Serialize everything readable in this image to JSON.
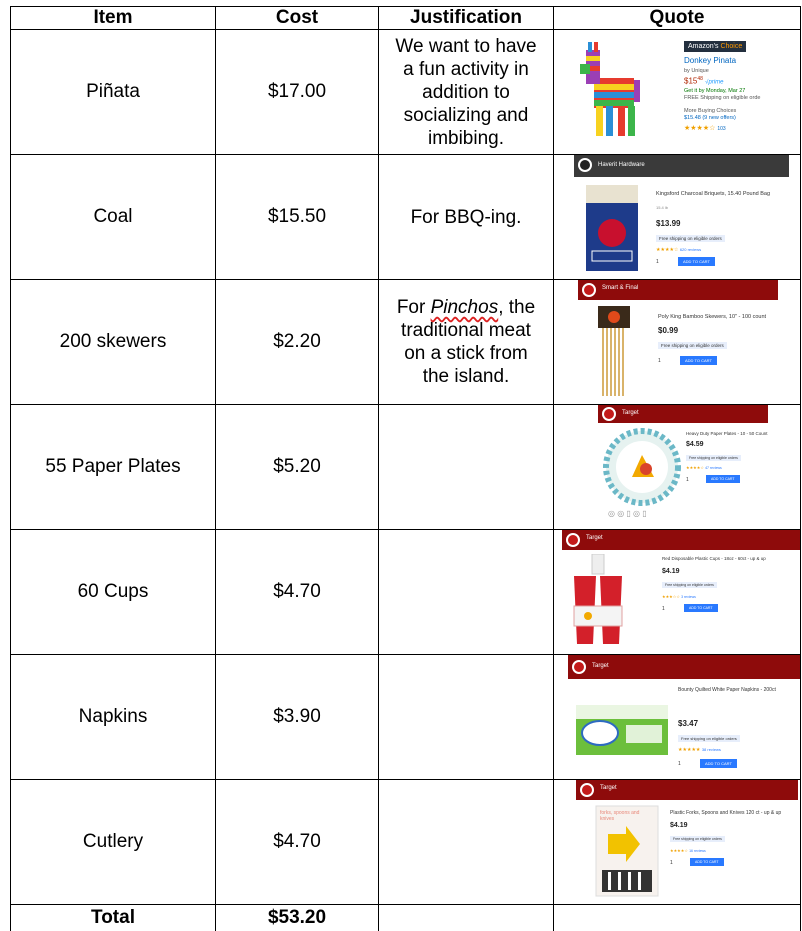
{
  "headers": {
    "item": "Item",
    "cost": "Cost",
    "justification": "Justification",
    "quote": "Quote"
  },
  "rows": [
    {
      "item": "Piñata",
      "cost": "$17.00",
      "justification_pre": "We want to have a fun activity in addition to socializing and imbibing.",
      "justification_em": "",
      "justification_post": ""
    },
    {
      "item": "Coal",
      "cost": "$15.50",
      "justification_pre": "For BBQ-ing.",
      "justification_em": "",
      "justification_post": ""
    },
    {
      "item": "200 skewers",
      "cost": "$2.20",
      "justification_pre": "For ",
      "justification_em": "Pinchos",
      "justification_post": ", the traditional meat on a stick from the island."
    },
    {
      "item": "55 Paper Plates",
      "cost": "$5.20",
      "justification_pre": "",
      "justification_em": "",
      "justification_post": ""
    },
    {
      "item": "60 Cups",
      "cost": "$4.70",
      "justification_pre": "",
      "justification_em": "",
      "justification_post": ""
    },
    {
      "item": "Napkins",
      "cost": "$3.90",
      "justification_pre": "",
      "justification_em": "",
      "justification_post": ""
    },
    {
      "item": "Cutlery",
      "cost": "$4.70",
      "justification_pre": "",
      "justification_em": "",
      "justification_post": ""
    }
  ],
  "total": {
    "label": "Total",
    "cost": "$53.20"
  },
  "quotes": {
    "pinata": {
      "badge_a": "Amazon's",
      "badge_b": "Choice",
      "title": "Donkey Pinata",
      "by": "by Unique",
      "price": "$15",
      "cents": "48",
      "prime": "√prime",
      "delivery": "Get it by Monday, Mar 27",
      "shipping": "FREE Shipping on eligible orde",
      "buying": "More Buying Choices",
      "offers": "$15.48 (9 new offers)",
      "stars": "★★★★☆",
      "reviews": "103"
    },
    "coal": {
      "store": "Haverit Hardware",
      "title": "Kingsford Charcoal Briquets, 15.40 Pound Bag",
      "size": "15.4 lb",
      "price": "$13.99",
      "ship": "Free shipping on eligible orders",
      "stars": "★★★★☆",
      "reviews": "620 reviews",
      "qty": "1",
      "cart": "ADD TO CART"
    },
    "skewers": {
      "store": "Smart & Final",
      "title": "Poly King Bamboo Skewers, 10\" - 100 count",
      "price": "$0.99",
      "ship": "Free shipping on eligible orders",
      "qty": "1",
      "cart": "ADD TO CART"
    },
    "plates": {
      "store": "Target",
      "title": "Heavy Duty Paper Plates - 10 - 50 Count",
      "price": "$4.59",
      "ship": "Free shipping on eligible orders",
      "stars": "★★★★☆",
      "reviews": "47 reviews",
      "qty": "1",
      "cart": "ADD TO CART"
    },
    "cups": {
      "store": "Target",
      "title": "Red Disposable Plastic Cups - 18oz - 60ct - up & up",
      "price": "$4.19",
      "ship": "Free shipping on eligible orders",
      "stars": "★★★☆☆",
      "reviews": "3 reviews",
      "qty": "1",
      "cart": "ADD TO CART"
    },
    "napkins": {
      "store": "Target",
      "title": "Bounty Quilted White Paper Napkins - 200ct",
      "price": "$3.47",
      "ship": "Free shipping on eligible orders",
      "stars": "★★★★★",
      "reviews": "38 reviews",
      "qty": "1",
      "cart": "ADD TO CART"
    },
    "cutlery": {
      "store": "Target",
      "title": "Plastic Forks, Spoons and Knives 120 ct - up & up",
      "price": "$4.19",
      "ship": "Free shipping on eligible orders",
      "stars": "★★★★☆",
      "reviews": "16 reviews",
      "qty": "1",
      "cart": "ADD TO CART",
      "pkg": "forks, spoons and knives"
    }
  },
  "colors": {
    "target_red": "#8e0b0b",
    "amazon_dark": "#232f3e",
    "cart_blue": "#2979ff"
  }
}
